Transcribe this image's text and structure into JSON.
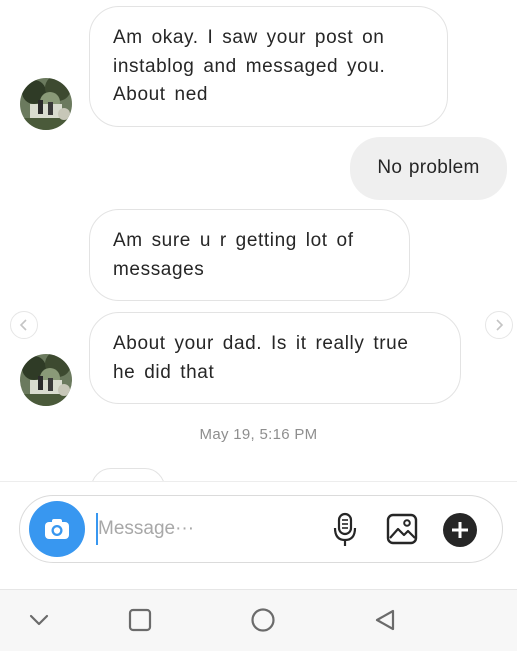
{
  "conversation": {
    "messages": [
      {
        "sender": "them",
        "text_lines": [
          "Am okay. I saw your post on",
          "instablog and messaged you.",
          "About ned"
        ]
      },
      {
        "sender": "me",
        "text_lines": [
          "No problem"
        ]
      },
      {
        "sender": "them",
        "text_lines": [
          "Am sure u r getting lot of",
          "messages"
        ]
      },
      {
        "sender": "them",
        "text_lines": [
          "About your dad. Is it really true",
          "he did that"
        ]
      }
    ],
    "timestamp": "May 19, 5:16 PM"
  },
  "composer": {
    "placeholder": "Message···",
    "icons": [
      "camera-icon",
      "microphone-icon",
      "gallery-icon",
      "plus-icon"
    ]
  },
  "system_nav": {
    "icons": [
      "chevron-down-icon",
      "recents-square-icon",
      "home-circle-icon",
      "back-triangle-icon"
    ]
  },
  "colors": {
    "accent": "#3897f0",
    "incoming_border": "#e3e3e3",
    "outgoing_bg": "#efefef",
    "text": "#262626",
    "timestamp": "#8e8e8e"
  }
}
